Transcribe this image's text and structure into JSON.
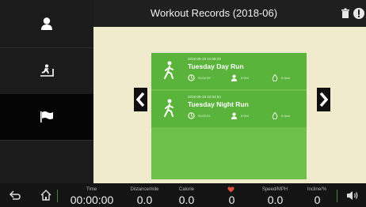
{
  "header": {
    "title": "Workout Records (2018-06)"
  },
  "records": [
    {
      "date": "2018-06-19 14:08:29",
      "name": "Tuesday Day Run",
      "time": "00:01:59",
      "distance": "0.0mi",
      "calories": "0.0cal"
    },
    {
      "date": "2018-06-19 22:04:54",
      "name": "Tuesday Night Run",
      "time": "00:02:01",
      "distance": "0.0mi",
      "calories": "0.0cal"
    }
  ],
  "status": {
    "time_label": "Time",
    "time_value": "00:00:00",
    "distance_label": "Distance/mile",
    "distance_value": "0.0",
    "calorie_label": "Calorie",
    "calorie_value": "0.0",
    "heart_value": "0",
    "speed_label": "Speed/MPH",
    "speed_value": "0.0",
    "incline_label": "Incline/%",
    "incline_value": "0"
  },
  "colors": {
    "accent_green": "#6cc24a",
    "heart": "#e0533a",
    "content_bg": "#f1ebcd"
  }
}
